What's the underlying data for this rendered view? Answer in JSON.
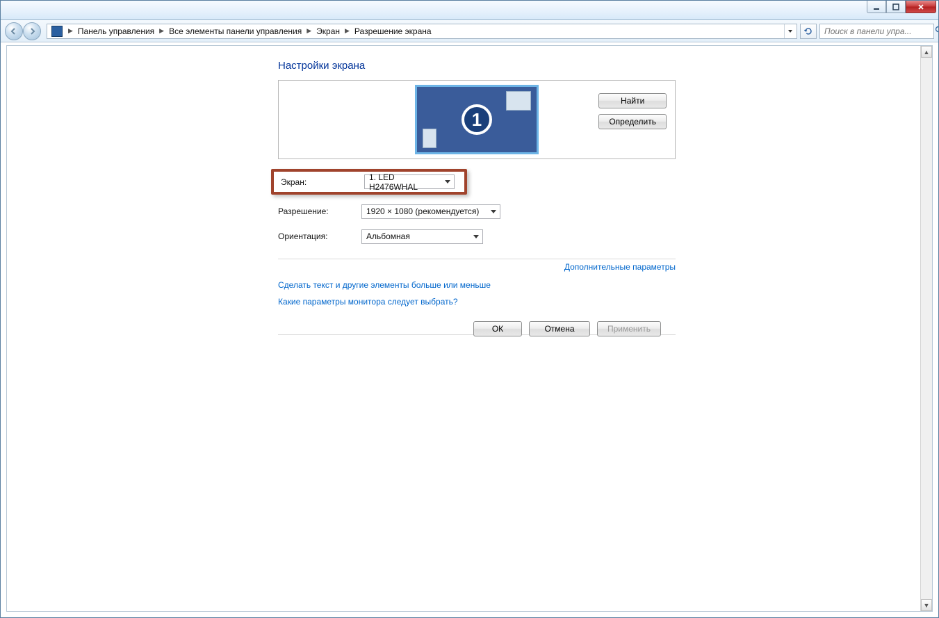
{
  "breadcrumb": {
    "items": [
      "Панель управления",
      "Все элементы панели управления",
      "Экран",
      "Разрешение экрана"
    ]
  },
  "search": {
    "placeholder": "Поиск в панели упра..."
  },
  "page": {
    "title": "Настройки экрана"
  },
  "preview": {
    "monitor_number": "1",
    "find_button": "Найти",
    "identify_button": "Определить"
  },
  "settings": {
    "screen_label": "Экран:",
    "screen_value": "1. LED H2476WHAL",
    "resolution_label": "Разрешение:",
    "resolution_value": "1920 × 1080 (рекомендуется)",
    "orientation_label": "Ориентация:",
    "orientation_value": "Альбомная"
  },
  "links": {
    "advanced": "Дополнительные параметры",
    "text_size": "Сделать текст и другие элементы больше или меньше",
    "which_monitor": "Какие параметры монитора следует выбрать?"
  },
  "buttons": {
    "ok": "ОК",
    "cancel": "Отмена",
    "apply": "Применить"
  }
}
